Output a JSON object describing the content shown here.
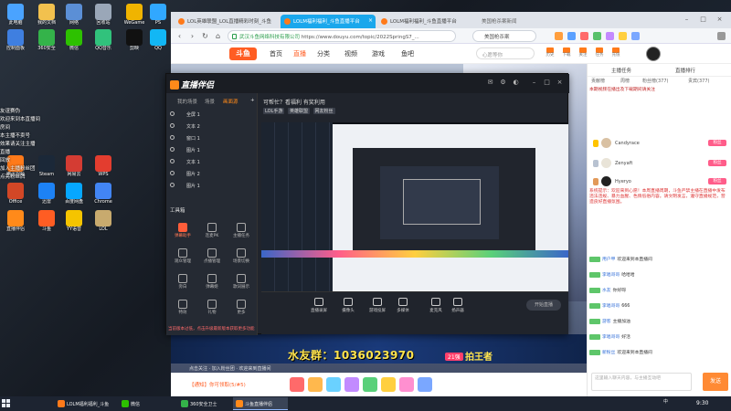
{
  "desktop": {
    "icons": [
      {
        "label": "此电脑",
        "color": "#4aa3ff"
      },
      {
        "label": "我的文档",
        "color": "#f2c14e"
      },
      {
        "label": "网络",
        "color": "#5b8fd6"
      },
      {
        "label": "回收站",
        "color": "#9aa7b8"
      },
      {
        "label": "控制面板",
        "color": "#3f7fe0"
      },
      {
        "label": "360安全",
        "color": "#34b34a"
      },
      {
        "label": "微信",
        "color": "#2dc100"
      },
      {
        "label": "QQ音乐",
        "color": "#31c27c"
      },
      {
        "label": "腾讯视频",
        "color": "#ff7a1a"
      },
      {
        "label": "Steam",
        "color": "#1b2838"
      },
      {
        "label": "网易云",
        "color": "#d43c33"
      },
      {
        "label": "WPS",
        "color": "#e33d2f"
      },
      {
        "label": "Office",
        "color": "#d24726"
      },
      {
        "label": "迅雷",
        "color": "#1d82f5"
      },
      {
        "label": "百度网盘",
        "color": "#06a7ff"
      },
      {
        "label": "Chrome",
        "color": "#4285f4"
      },
      {
        "label": "直播伴侣",
        "color": "#ff8a1a"
      },
      {
        "label": "斗鱼",
        "color": "#ff5d23"
      },
      {
        "label": "YY语音",
        "color": "#f5c400"
      },
      {
        "label": "LOL",
        "color": "#c8aa6e"
      },
      {
        "label": "WeGame",
        "color": "#f0b400"
      },
      {
        "label": "PS",
        "color": "#31a8ff"
      },
      {
        "label": "剪映",
        "color": "#111111"
      },
      {
        "label": "QQ",
        "color": "#12b7f5"
      }
    ],
    "notes": [
      "友谊赛伪",
      "欢迎来到本直播间",
      "房间",
      "本主播不卖号",
      "效果请关注主播",
      "直播",
      "回放",
      "加入主播粉丝团",
      "点亮粉丝牌"
    ]
  },
  "browser": {
    "tabs": [
      {
        "label": "LOL英雄联盟_LOL直播精彩时刻_斗鱼",
        "active": false
      },
      {
        "label": "LOLM福利福利_斗鱼直播平台",
        "active": true
      },
      {
        "label": "LOLM福利福利_斗鱼直播平台",
        "active": false
      }
    ],
    "new_tab_hint": "美国枪杀案新闻",
    "url_org": "武汉斗鱼网络科技有限公司",
    "url": "https://www.douyu.com/topic/2022SpringS7_...",
    "search_text": "美国枪杀案",
    "site": {
      "logo": "斗鱼",
      "nav": [
        "首页",
        "直播",
        "分类",
        "视频",
        "游戏",
        "鱼吧"
      ],
      "active_nav": 1,
      "search_placeholder": "心愿等你",
      "header_icons": [
        "历史",
        "下载",
        "关注",
        "任务",
        "充值"
      ]
    }
  },
  "stream": {
    "banner_title": "水友群：1036023970",
    "banner_tag": "21强",
    "banner_sub": "拍王者",
    "ticker": "点击关注 · 加入粉丝团 · 欢迎来到直播间",
    "chat_prompt": "【通知】你可领取(5/#5)",
    "gifts": [
      "#ff6a6a",
      "#ffb84d",
      "#6ad1ff",
      "#c28bff",
      "#59d07a",
      "#ffcf3f",
      "#ff8fd0",
      "#7aa7ff"
    ]
  },
  "side": {
    "tabs": [
      "主播任务",
      "直播排行"
    ],
    "subtabs": [
      "贡献榜",
      "周榜",
      "粉丝榜(377)",
      "贵宾(377)"
    ],
    "notice": "本期视频在播出及下载期间请关注",
    "ranks": [
      {
        "name": "Candyrace",
        "badge": "粉丝"
      },
      {
        "name": "Zenyaft",
        "badge": "粉丝"
      },
      {
        "name": "Hyeryo",
        "badge": "粉丝"
      }
    ],
    "sys_msg": "系统提示：欢迎来到心愿！本周直播周期，斗鱼严禁主播在直播中发布违法违规、暴力血腥、色情低俗内容。请文明发言，遵守直播规范，营造良好直播氛围。",
    "chat": [
      {
        "user": "用户甲",
        "text": "欢迎来到本直播间"
      },
      {
        "user": "李唱哥哥",
        "text": "哈哈哈"
      },
      {
        "user": "水友",
        "text": "你好呀"
      },
      {
        "user": "李唱哥哥",
        "text": "666"
      },
      {
        "user": "游客",
        "text": "主播加油"
      },
      {
        "user": "李唱哥哥",
        "text": "好活"
      },
      {
        "user": "新粉丝",
        "text": "欢迎来到本直播间"
      }
    ],
    "input_placeholder": "这里输入聊天内容，与主播互动吧",
    "send": "发送"
  },
  "app": {
    "logo": "直播伴侣",
    "left_tabs": [
      "我的场景",
      "场景",
      "画面源"
    ],
    "active_tab": 2,
    "scenes": [
      "全屏 1",
      "文本 2",
      "窗口 1",
      "图片 1",
      "文本 1",
      "图片 2",
      "图片 1"
    ],
    "tool_head": "工具箱",
    "tools": [
      {
        "label": "弹幕助手",
        "hot": true
      },
      {
        "label": "连麦PK",
        "hot": false
      },
      {
        "label": "主播任务",
        "hot": false
      },
      {
        "label": "观众管理",
        "hot": false
      },
      {
        "label": "点播管理",
        "hot": false
      },
      {
        "label": "场景切换",
        "hot": false
      },
      {
        "label": "旁白",
        "hot": false
      },
      {
        "label": "弹幕姬",
        "hot": false
      },
      {
        "label": "歌词展示",
        "hot": false
      },
      {
        "label": "特效",
        "hot": false
      },
      {
        "label": "礼物",
        "hot": false
      },
      {
        "label": "更多",
        "hot": false
      }
    ],
    "notice": "当前版本过低，点击升级最新版本获取更多功能",
    "top_title": "可帮忙？看福利 有奖利用",
    "top_sub1": "LOL手游",
    "top_sub2": "英雄联盟",
    "top_sub3": "网友粉丝",
    "bottom_buttons": [
      "直播录屏",
      "摄像头",
      "游戏投屏",
      "多媒体",
      "麦克风",
      "扬声器"
    ],
    "live_button": "开始直播"
  },
  "taskbar": {
    "tasks": [
      {
        "label": "LOLM福利福利_斗鱼",
        "color": "#ff7a1a",
        "active": false
      },
      {
        "label": "微信",
        "color": "#2dc100",
        "active": false
      },
      {
        "label": "360安全卫士",
        "color": "#34b34a",
        "active": false
      },
      {
        "label": "斗鱼直播伴侣",
        "color": "#ff8a1a",
        "active": true
      }
    ],
    "tray": "中",
    "clock": "9:30"
  }
}
